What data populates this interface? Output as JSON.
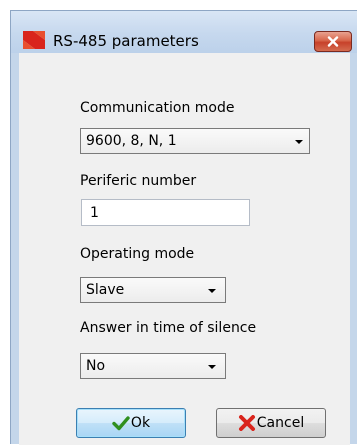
{
  "dialog": {
    "title": "RS-485 parameters",
    "accent_color": "#d9241c"
  },
  "communication_mode": {
    "label": "Communication mode",
    "value": "9600, 8, N, 1"
  },
  "periferic_number": {
    "label": "Periferic number",
    "value": "1"
  },
  "operating_mode": {
    "label": "Operating mode",
    "value": "Slave"
  },
  "answer_silence": {
    "label": "Answer in time of silence",
    "value": "No"
  },
  "buttons": {
    "ok_label": "Ok",
    "cancel_label": "Cancel"
  },
  "icons": {
    "app": "rs485-logo-icon",
    "close": "close-icon",
    "dropdown": "chevron-down-icon",
    "ok": "checkmark-icon",
    "cancel": "cross-icon"
  }
}
